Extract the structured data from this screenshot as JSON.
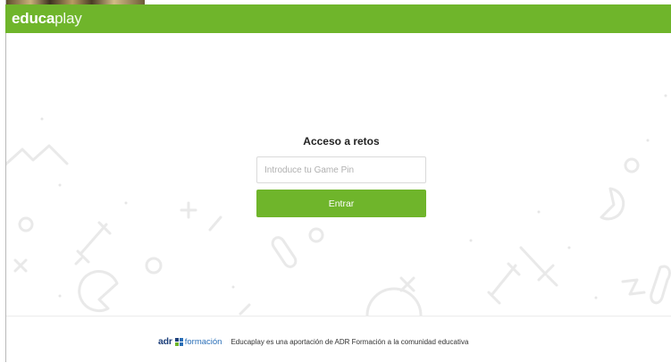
{
  "header": {
    "logo_bold": "educa",
    "logo_light": "play",
    "bar_color": "#6fb52b"
  },
  "login": {
    "title": "Acceso a retos",
    "pin_placeholder": "Introduce tu Game Pin",
    "pin_value": "",
    "submit_label": "Entrar"
  },
  "footer": {
    "brand_adr": "adr",
    "brand_formacion": "formación",
    "brand_square_colors": [
      "#1d3f7a",
      "#2a6fb8",
      "#6fb52b",
      "#2a6fb8"
    ],
    "text": "Educaplay es una aportación de ADR Formación a la comunidad educativa"
  },
  "background": {
    "doodle_icons": [
      "zigzag-icon",
      "circle-icon",
      "plus-icon",
      "sword-icon",
      "pacman-icon",
      "bone-icon",
      "x-icon",
      "dot-icon"
    ],
    "doodle_color": "#e9e9e9"
  }
}
